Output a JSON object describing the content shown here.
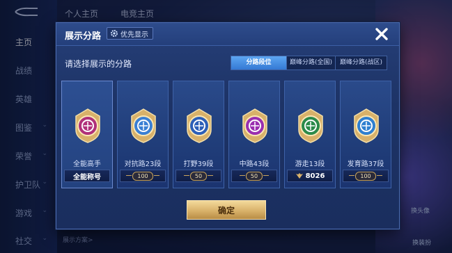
{
  "background": {
    "top_tabs": [
      "个人主页",
      "电竞主页"
    ],
    "sidebar": [
      {
        "label": "主页",
        "chevron": false,
        "active": true
      },
      {
        "label": "战绩",
        "chevron": false,
        "active": false
      },
      {
        "label": "英雄",
        "chevron": false,
        "active": false
      },
      {
        "label": "图鉴",
        "chevron": true,
        "active": false
      },
      {
        "label": "荣誉",
        "chevron": true,
        "active": false
      },
      {
        "label": "护卫队",
        "chevron": true,
        "active": false
      },
      {
        "label": "游戏",
        "chevron": true,
        "active": false
      },
      {
        "label": "社交",
        "chevron": true,
        "active": false
      }
    ],
    "bottom_text": "展示方案>",
    "right_labels": [
      "换头像",
      "换装扮"
    ]
  },
  "modal": {
    "title": "展示分路",
    "priority_label": "优先显示",
    "question": "请选择展示的分路",
    "segments": [
      "分路段位",
      "巅峰分路(全国)",
      "巅峰分路(战区)"
    ],
    "active_segment": 0,
    "cards": [
      {
        "role": "全能高手",
        "rank": "全能称号",
        "rank_type": "title",
        "color": "#b0307a"
      },
      {
        "role": "对抗路23段",
        "rank": "100",
        "rank_type": "pill",
        "color": "#3a7fd4"
      },
      {
        "role": "打野39段",
        "rank": "50",
        "rank_type": "pill",
        "color": "#2c5fb8"
      },
      {
        "role": "中路43段",
        "rank": "50",
        "rank_type": "pill",
        "color": "#9a2fb0"
      },
      {
        "role": "游走13段",
        "rank": "8026",
        "rank_type": "points",
        "color": "#2b8a4a"
      },
      {
        "role": "发育路37段",
        "rank": "100",
        "rank_type": "pill",
        "color": "#2f7fd0"
      }
    ],
    "confirm_label": "确定"
  },
  "colors": {
    "accent_blue": "#3479d4",
    "confirm_gold": "#d9b26a",
    "panel": "#1d3366"
  }
}
